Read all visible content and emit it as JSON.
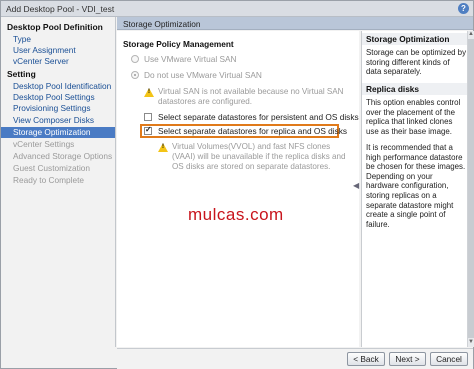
{
  "window": {
    "title": "Add Desktop Pool - VDI_test",
    "help_glyph": "?"
  },
  "sidebar": {
    "section1": "Desktop Pool Definition",
    "items1": [
      "Type",
      "User Assignment",
      "vCenter Server"
    ],
    "section2": "Setting",
    "items2": [
      "Desktop Pool Identification",
      "Desktop Pool Settings",
      "Provisioning Settings",
      "View Composer Disks",
      "Storage Optimization",
      "vCenter Settings",
      "Advanced Storage Options",
      "Guest Customization",
      "Ready to Complete"
    ],
    "active_item": "Storage Optimization"
  },
  "pane": {
    "header": "Storage Optimization"
  },
  "content": {
    "section_title": "Storage Policy Management",
    "radio_vsan": "Use VMware Virtual SAN",
    "radio_no_vsan": "Do not use VMware Virtual SAN",
    "warning_vsan": "Virtual SAN is not available because no Virtual SAN datastores are configured.",
    "check_persistent": "Select separate datastores for persistent and OS disks",
    "check_replica": "Select separate datastores for replica and OS disks",
    "check_replica_checked": true,
    "warning_vvol": "Virtual Volumes(VVOL) and fast NFS clones (VAAI) will be unavailable if the replica disks and OS disks are stored on separate datastores.",
    "watermark": "mulcas.com"
  },
  "help": {
    "heading1": "Storage Optimization",
    "text1": "Storage can be optimized by storing different kinds of data separately.",
    "heading2": "Replica disks",
    "text2": "This option enables control over the placement of the replica that linked clones use as their base image.",
    "text3": "It is recommended that a high performance datastore be chosen for these images. Depending on your hardware configuration, storing replicas on a separate datastore might create a single point of failure."
  },
  "footer": {
    "back": "< Back",
    "next": "Next >",
    "cancel": "Cancel"
  },
  "icons": {
    "warning": "warning-triangle-icon",
    "help": "help-icon",
    "accent": "#4a7bc4",
    "highlight": "#e07a1a"
  }
}
